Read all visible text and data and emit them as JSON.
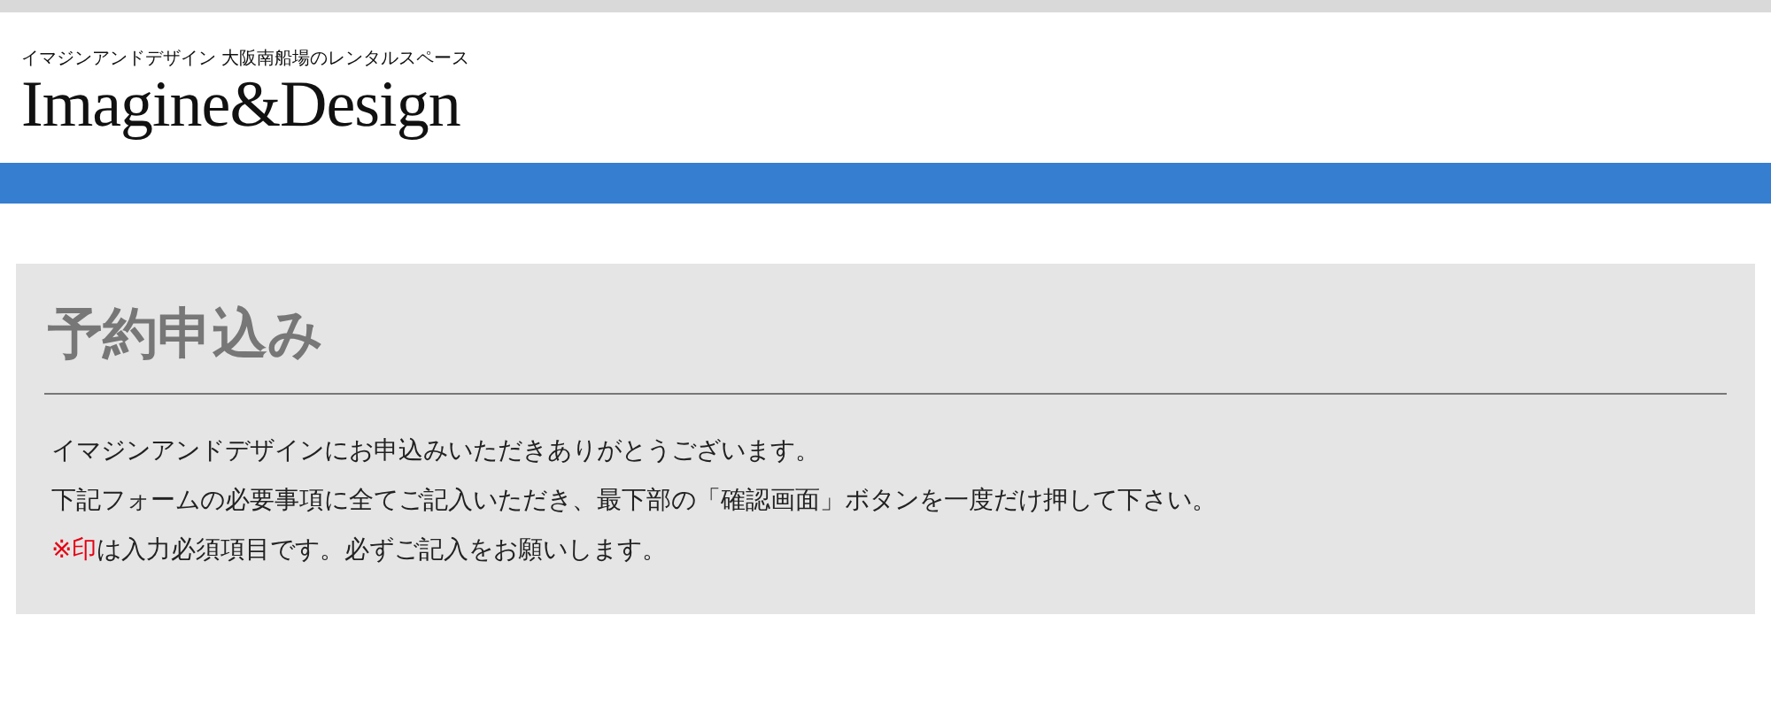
{
  "header": {
    "tagline": "イマジンアンドデザイン 大阪南船場のレンタルスペース",
    "logo": "Imagine&Design"
  },
  "section": {
    "title": "予約申込み",
    "paragraphs": [
      {
        "text": "イマジンアンドデザインにお申込みいただきありがとうございます。"
      },
      {
        "text": "下記フォームの必要事項に全てご記入いただき、最下部の「確認画面」ボタンを一度だけ押して下さい。"
      },
      {
        "mark": "※印",
        "text": "は入力必須項目です。必ずご記入をお願いします。"
      }
    ]
  }
}
